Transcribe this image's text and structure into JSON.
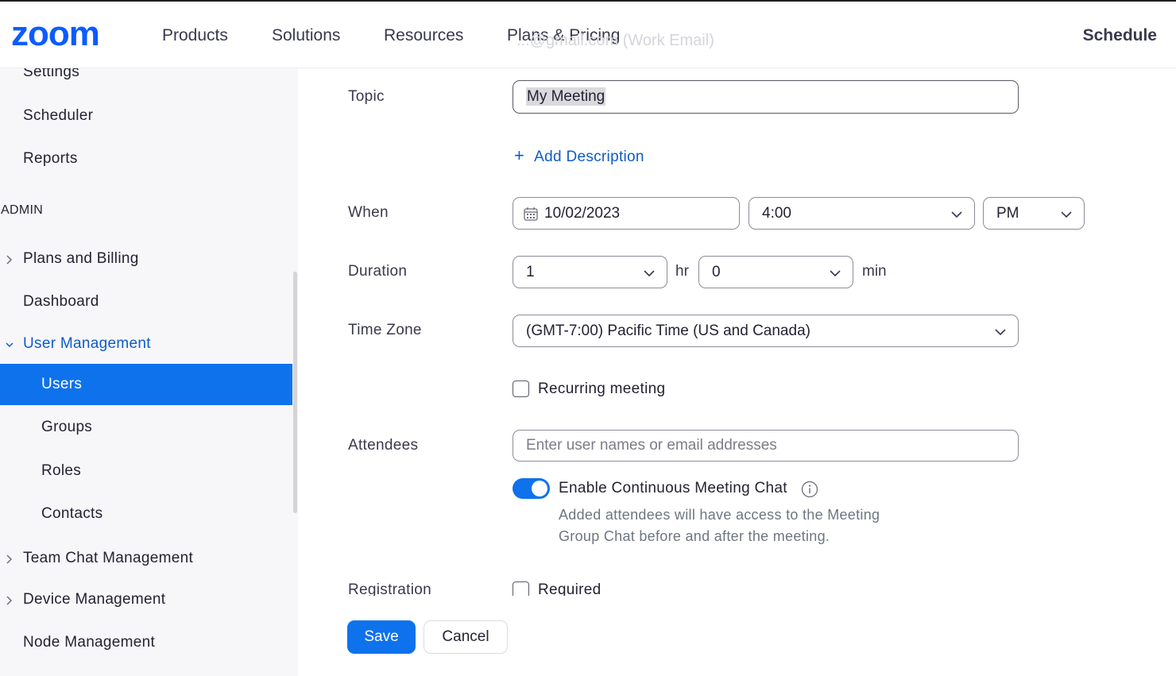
{
  "header": {
    "logo": "zoom",
    "nav": [
      "Products",
      "Solutions",
      "Resources",
      "Plans & Pricing"
    ],
    "schedule": "Schedule",
    "ghost_text": "...@gmail.com (Work Email)"
  },
  "sidebar": {
    "items_top": [
      "Settings",
      "Scheduler",
      "Reports"
    ],
    "section_admin": "ADMIN",
    "plans_billing": "Plans and Billing",
    "dashboard": "Dashboard",
    "user_management": "User Management",
    "users": "Users",
    "groups": "Groups",
    "roles": "Roles",
    "contacts": "Contacts",
    "team_chat": "Team Chat Management",
    "device_mgmt": "Device Management",
    "node_mgmt": "Node Management"
  },
  "form": {
    "topic_label": "Topic",
    "topic_value": "My Meeting",
    "add_description": "Add Description",
    "when_label": "When",
    "date_value": "10/02/2023",
    "time_value": "4:00",
    "ampm_value": "PM",
    "duration_label": "Duration",
    "duration_hr": "1",
    "hr_unit": "hr",
    "duration_min": "0",
    "min_unit": "min",
    "timezone_label": "Time Zone",
    "timezone_value": "(GMT-7:00) Pacific Time (US and Canada)",
    "recurring_label": "Recurring meeting",
    "attendees_label": "Attendees",
    "attendees_placeholder": "Enter user names or email addresses",
    "continuous_chat_label": "Enable Continuous Meeting Chat",
    "help_line1": "Added attendees will have access to the Meeting",
    "help_line2": "Group Chat before and after the meeting.",
    "registration_label": "Registration",
    "required_label": "Required",
    "continuous_chat_enabled": true,
    "recurring_checked": false,
    "required_checked": false
  },
  "buttons": {
    "save": "Save",
    "cancel": "Cancel"
  },
  "colors": {
    "brand_blue": "#0e72ed",
    "link_blue": "#0e5cc7",
    "sidebar_bg": "#f7f7fa"
  },
  "icons": [
    "chevron-right-icon",
    "chevron-down-icon",
    "calendar-icon",
    "info-icon",
    "plus-icon"
  ]
}
